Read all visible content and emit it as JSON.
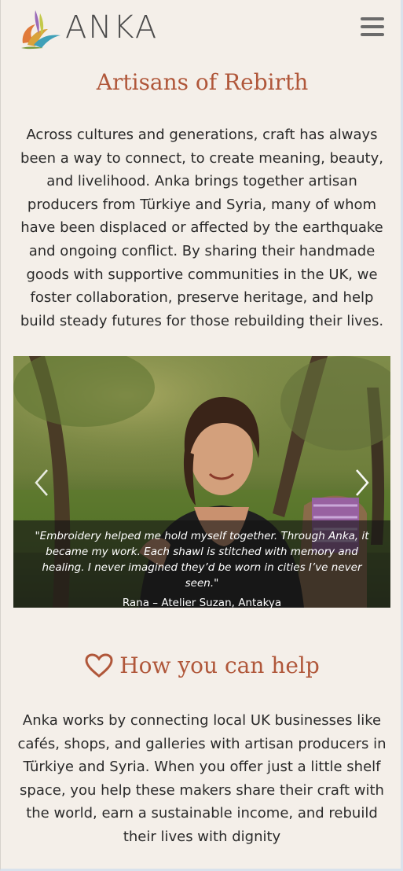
{
  "header": {
    "logo_text": "ANKA",
    "menu_icon": "hamburger-menu-icon"
  },
  "artisans": {
    "title": "Artisans of Rebirth",
    "intro": "Across cultures and generations, craft has always been a way to connect, to create meaning, beauty, and livelihood. Anka brings together artisan producers from Türkiye and Syria, many of whom have been displaced or affected by the earthquake and ongoing conflict. By sharing their handmade goods with supportive communities in the UK, we foster collaboration, preserve heritage, and help build steady futures for those rebuilding their lives."
  },
  "carousel": {
    "slide": {
      "quote": "\"Embroidery helped me hold myself together. Through Anka, it became my work. Each shawl is stitched with memory and healing. I never imagined they’d be worn in cities I’ve never seen.\"",
      "attribution": "Rana – Atelier Suzan, Antakya"
    },
    "prev_icon": "chevron-left-icon",
    "next_icon": "chevron-right-icon"
  },
  "help": {
    "icon": "heart-outline-icon",
    "title": "How you can help",
    "text": "Anka works by connecting local UK businesses like cafés, shops, and galleries with artisan producers in Türkiye and Syria. When you offer just a little shelf space, you help these makers share their craft with the world, earn a sustainable income, and rebuild their lives with dignity"
  },
  "colors": {
    "background": "#f4efe9",
    "accent": "#b0573a",
    "text": "#2a2a2a"
  }
}
